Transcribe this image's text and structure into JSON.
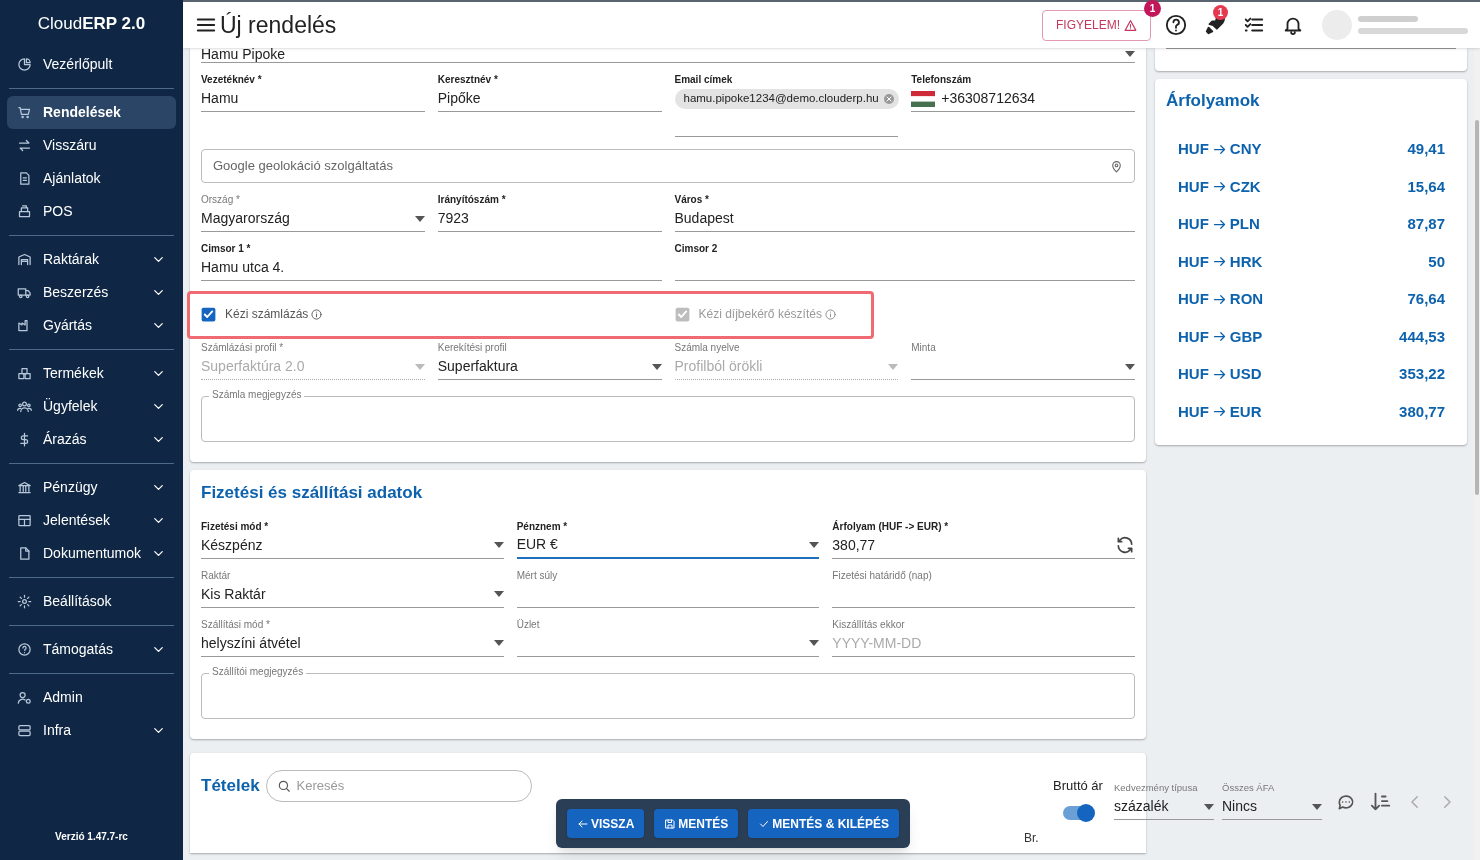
{
  "app": {
    "logo_light": "Cloud",
    "logo_bold": "ERP 2.0",
    "version": "Verzió 1.47.7-rc"
  },
  "sidebar": {
    "groups": [
      [
        {
          "label": "Vezérlőpult",
          "selected": false,
          "expandable": false
        }
      ],
      [
        {
          "label": "Rendelések",
          "selected": true,
          "expandable": false
        },
        {
          "label": "Visszáru",
          "selected": false,
          "expandable": false
        },
        {
          "label": "Ajánlatok",
          "selected": false,
          "expandable": false
        },
        {
          "label": "POS",
          "selected": false,
          "expandable": false
        }
      ],
      [
        {
          "label": "Raktárak",
          "selected": false,
          "expandable": true
        },
        {
          "label": "Beszerzés",
          "selected": false,
          "expandable": true
        },
        {
          "label": "Gyártás",
          "selected": false,
          "expandable": true
        }
      ],
      [
        {
          "label": "Termékek",
          "selected": false,
          "expandable": true
        },
        {
          "label": "Ügyfelek",
          "selected": false,
          "expandable": true
        },
        {
          "label": "Árazás",
          "selected": false,
          "expandable": true
        }
      ],
      [
        {
          "label": "Pénzügy",
          "selected": false,
          "expandable": true
        },
        {
          "label": "Jelentések",
          "selected": false,
          "expandable": true
        },
        {
          "label": "Dokumentumok",
          "selected": false,
          "expandable": true
        }
      ],
      [
        {
          "label": "Beállítások",
          "selected": false,
          "expandable": false
        }
      ],
      [
        {
          "label": "Támogatás",
          "selected": false,
          "expandable": true
        }
      ],
      [
        {
          "label": "Admin",
          "selected": false,
          "expandable": false
        },
        {
          "label": "Infra",
          "selected": false,
          "expandable": true
        }
      ]
    ]
  },
  "header": {
    "title": "Új rendelés",
    "warning_button": "FIGYELEM!",
    "warning_badge": "1",
    "rocket_badge": "1"
  },
  "customer": {
    "select_value": "Hamu Pipoke",
    "rows": [
      [
        {
          "kind": "text",
          "label": "Vezetéknév *",
          "label_bold": true,
          "value": "Hamu"
        },
        {
          "kind": "text",
          "label": "Keresztnév *",
          "label_bold": true,
          "value": "Pipőke"
        },
        {
          "kind": "chips",
          "label": "Email címek",
          "label_bold": true,
          "value": "hamu.pipoke1234@demo.clouderp.hu"
        },
        {
          "kind": "phone",
          "label": "Telefonszám",
          "label_bold": true,
          "value": "+36308712634"
        }
      ]
    ],
    "geolocation_placeholder": "Google geolokáció szolgáltatás",
    "address_rows": [
      [
        {
          "kind": "select",
          "label": "Ország *",
          "label_bold": false,
          "value": "Magyarország"
        },
        {
          "kind": "text",
          "label": "Irányítószám *",
          "label_bold": true,
          "value": "7923"
        },
        {
          "kind": "text",
          "label": "Város *",
          "label_bold": true,
          "value": "Budapest"
        }
      ],
      [
        {
          "kind": "text",
          "label": "Cimsor 1 *",
          "label_bold": true,
          "value": "Hamu utca 4."
        },
        {
          "kind": "text",
          "label": "Cimsor 2",
          "label_bold": true
        }
      ]
    ],
    "checkboxes": [
      {
        "label": "Kézi számlázás",
        "checked": true,
        "disabled": false
      },
      {
        "label": "Kézi díjbekérő készítés",
        "checked": true,
        "disabled": true
      }
    ],
    "invoice_rows": [
      [
        {
          "kind": "select",
          "label": "Számlázási profil *",
          "label_bold": false,
          "value": "Superfaktúra 2.0",
          "disabled": true
        },
        {
          "kind": "select",
          "label": "Kerekítési profil",
          "label_bold": false,
          "value": "Superfaktura",
          "disabled": false
        },
        {
          "kind": "select",
          "label": "Számla nyelve",
          "label_bold": false,
          "value": "Profilból örökli",
          "disabled": true
        },
        {
          "kind": "select",
          "label": "Minta",
          "label_bold": false,
          "disabled": false
        }
      ]
    ],
    "note_label": "Számla megjegyzés"
  },
  "payment": {
    "title": "Fizetési és szállítási adatok",
    "rows": [
      [
        {
          "kind": "select",
          "label": "Fizetési mód *",
          "label_bold": true,
          "value": "Készpénz",
          "focused": false
        },
        {
          "kind": "select",
          "label": "Pénznem *",
          "label_bold": true,
          "value": "EUR €",
          "focused": true
        },
        {
          "kind": "refresh",
          "label": "Árfolyam (HUF -> EUR) *",
          "label_bold": true,
          "value": "380,77",
          "focused": false
        }
      ],
      [
        {
          "kind": "select",
          "label": "Raktár",
          "label_bold": false,
          "value": "Kis Raktár",
          "focused": false
        },
        {
          "kind": "text",
          "label": "Mért súly",
          "label_bold": false,
          "focused": false
        },
        {
          "kind": "text",
          "label": "Fizetési határidő (nap)",
          "label_bold": false,
          "focused": false
        }
      ],
      [
        {
          "kind": "select",
          "label": "Szállítási mód *",
          "label_bold": false,
          "value": "helyszíni átvétel",
          "focused": false
        },
        {
          "kind": "select",
          "label": "Üzlet",
          "label_bold": false,
          "focused": false
        },
        {
          "kind": "date",
          "label": "Kiszállítás ekkor",
          "label_bold": false,
          "placeholder": "YYYY-MM-DD",
          "focused": false
        }
      ]
    ],
    "note_label": "Szállítói megjegyzés"
  },
  "rates": {
    "title": "Árfolyamok",
    "items": [
      {
        "from": "HUF",
        "to": "CNY",
        "value": "49,41"
      },
      {
        "from": "HUF",
        "to": "CZK",
        "value": "15,64"
      },
      {
        "from": "HUF",
        "to": "PLN",
        "value": "87,87"
      },
      {
        "from": "HUF",
        "to": "HRK",
        "value": "50"
      },
      {
        "from": "HUF",
        "to": "RON",
        "value": "76,64"
      },
      {
        "from": "HUF",
        "to": "GBP",
        "value": "444,53"
      },
      {
        "from": "HUF",
        "to": "USD",
        "value": "353,22"
      },
      {
        "from": "HUF",
        "to": "EUR",
        "value": "380,77"
      }
    ]
  },
  "items": {
    "title": "Tételek",
    "search_placeholder": "Keresés",
    "gross_label": "Bruttó ár",
    "gross_on": true,
    "discount": {
      "label": "Kedvezmény típusa",
      "value": "százalék"
    },
    "vat": {
      "label": "Összes ÁFA",
      "value": "Nincs"
    },
    "column_header": "Br."
  },
  "actions": [
    {
      "kind": "back",
      "label": "VISSZA"
    },
    {
      "kind": "save",
      "label": "MENTÉS"
    },
    {
      "kind": "save_exit",
      "label": "MENTÉS & KILÉPÉS"
    }
  ]
}
